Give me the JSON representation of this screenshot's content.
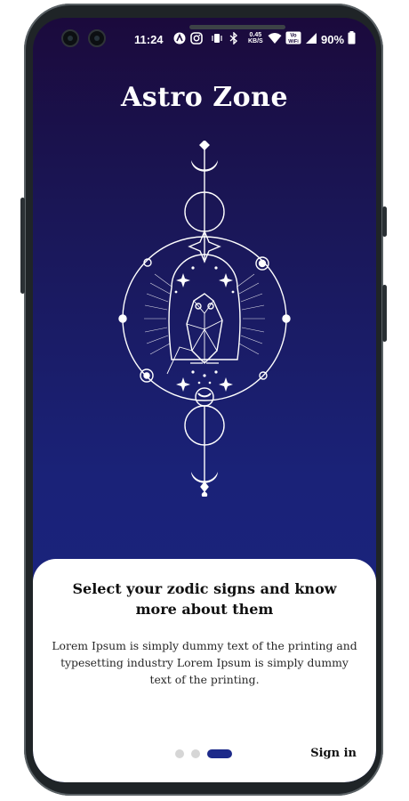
{
  "status_bar": {
    "time": "11:24",
    "net_speed": "0.45",
    "net_unit": "KB/S",
    "volte": "Vo",
    "wifi_label": "WiFi",
    "battery": "90%"
  },
  "app": {
    "title": "Astro Zone"
  },
  "onboarding": {
    "heading": "Select your zodic signs and know more about them",
    "body": "Lorem Ipsum is simply dummy text of the printing and typesetting industry Lorem Ipsum is simply dummy text of the printing.",
    "pages": 3,
    "current_page": 3,
    "sign_in_label": "Sign in"
  },
  "colors": {
    "background_top": "#1b0a3c",
    "background_bottom": "#1a2582",
    "accent": "#1d2a8a",
    "card": "#ffffff"
  }
}
